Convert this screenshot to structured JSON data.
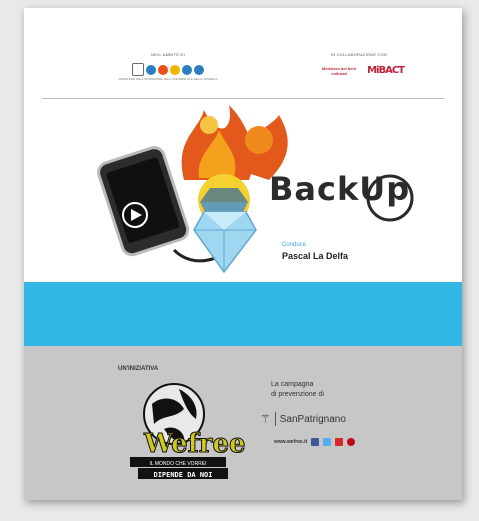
{
  "header": {
    "left_label": "NELL'AMBITO DI",
    "left_caption": "MINISTERO DELL'ISTRUZIONE, DELL'UNIVERSITÀ E DELLA RICERCA",
    "right_label": "IN COLLABORAZIONE CON",
    "right_caption": "Ministero dei beni culturali",
    "right_mark": "MiBACT"
  },
  "show": {
    "title": "BackUp",
    "host_label": "Conduce",
    "host_name": "Pascal La Delfa"
  },
  "footer": {
    "initiative_label": "UN'INIZIATIVA",
    "brand_name": "Wefree",
    "brand_line1": "IL MONDO CHE VORREI",
    "brand_line2": "DIPENDE DA NOI",
    "campaign_line1": "La campagna",
    "campaign_line2": "di prevenzione di",
    "sponsor": "SanPatrignano",
    "website": "www.wefree.it"
  },
  "colors": {
    "accent_blue": "#33b8e6",
    "footer_gray": "#c7c7c7",
    "flame_orange": "#e2591b"
  },
  "icons": [
    "phone-icon",
    "play-icon",
    "diamond-icon",
    "flame-icon",
    "globe-icon",
    "facebook-icon",
    "twitter-icon",
    "youtube-icon",
    "pinterest-icon"
  ]
}
